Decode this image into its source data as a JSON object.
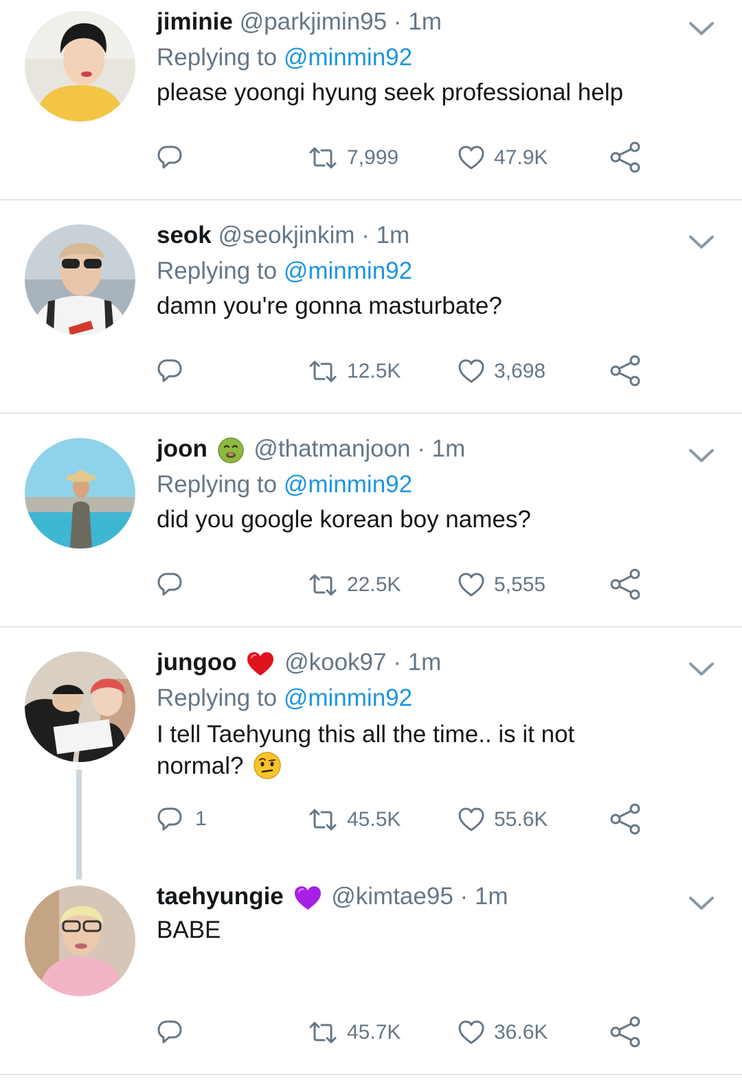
{
  "tweets": [
    {
      "name": "jiminie",
      "handle": "@parkjimin95",
      "time": "· 1m",
      "replying_label": "Replying to",
      "replying_to": "@minmin92",
      "text": "please yoongi hyung seek professional help",
      "replies": "",
      "retweets": "7,999",
      "likes": "47.9K"
    },
    {
      "name": "seok",
      "handle": "@seokjinkim",
      "time": "· 1m",
      "replying_label": "Replying to",
      "replying_to": "@minmin92",
      "text": "damn you're gonna masturbate?",
      "replies": "",
      "retweets": "12.5K",
      "likes": "3,698"
    },
    {
      "name": "joon",
      "name_emoji": "nauseated-face-emoji",
      "handle": "@thatmanjoon",
      "time": "· 1m",
      "replying_label": "Replying to",
      "replying_to": "@minmin92",
      "text": "did you google korean boy names?",
      "replies": "",
      "retweets": "22.5K",
      "likes": "5,555"
    },
    {
      "name": "jungoo",
      "name_emoji": "red-heart-emoji",
      "handle": "@kook97",
      "time": "· 1m",
      "replying_label": "Replying to",
      "replying_to": "@minmin92",
      "text_line1": "I tell Taehyung this all the time.. is it not",
      "text_line2": "normal?",
      "text_emoji": "face-with-raised-eyebrow-emoji",
      "replies": "1",
      "retweets": "45.5K",
      "likes": "55.6K"
    },
    {
      "name": "taehyungie",
      "name_emoji": "purple-heart-emoji",
      "handle": "@kimtae95",
      "time": "· 1m",
      "text": "BABE",
      "replies": "",
      "retweets": "45.7K",
      "likes": "36.6K"
    }
  ],
  "colors": {
    "link": "#1b95e0",
    "secondary": "#657786",
    "divider": "#e1e8ed",
    "thread_line": "#ccd6dd"
  },
  "icons": [
    "reply-icon",
    "retweet-icon",
    "like-icon",
    "share-icon",
    "chevron-down-icon"
  ]
}
